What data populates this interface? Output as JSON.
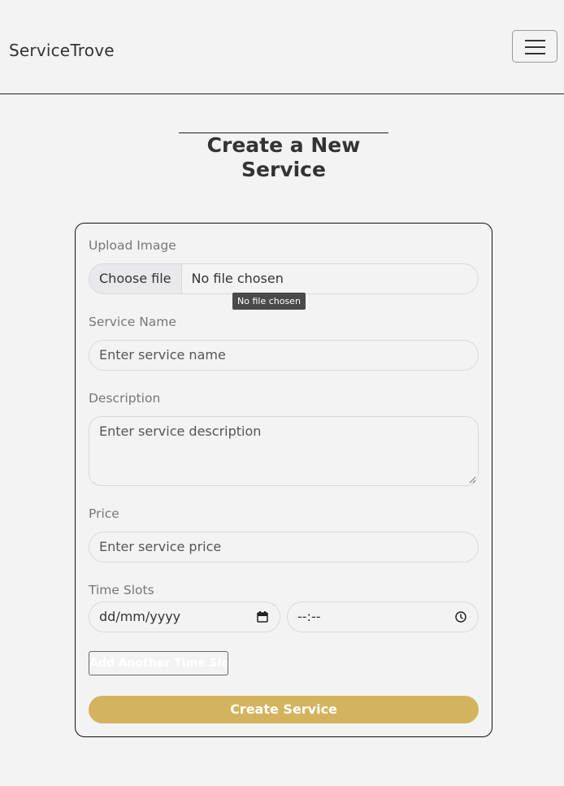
{
  "navbar": {
    "brand": "ServiceTrove",
    "menu_icon": "hamburger-menu-icon"
  },
  "page": {
    "title_line1": "Create a New",
    "title_line2": "Service"
  },
  "form": {
    "upload_label": "Upload Image",
    "file_button": "Choose file",
    "file_status": "No file chosen",
    "file_tooltip": "No file chosen",
    "name_label": "Service Name",
    "name_placeholder": "Enter service name",
    "description_label": "Description",
    "description_placeholder": "Enter service description",
    "price_label": "Price",
    "price_placeholder": "Enter service price",
    "timeslots_label": "Time Slots",
    "date_placeholder": "dd/mm/yyyy",
    "time_placeholder": "--:--",
    "add_slot_button": "Add Another Time Slot",
    "submit_button": "Create Service"
  },
  "colors": {
    "accent": "#d4b35e",
    "background": "#f3f3f3"
  }
}
